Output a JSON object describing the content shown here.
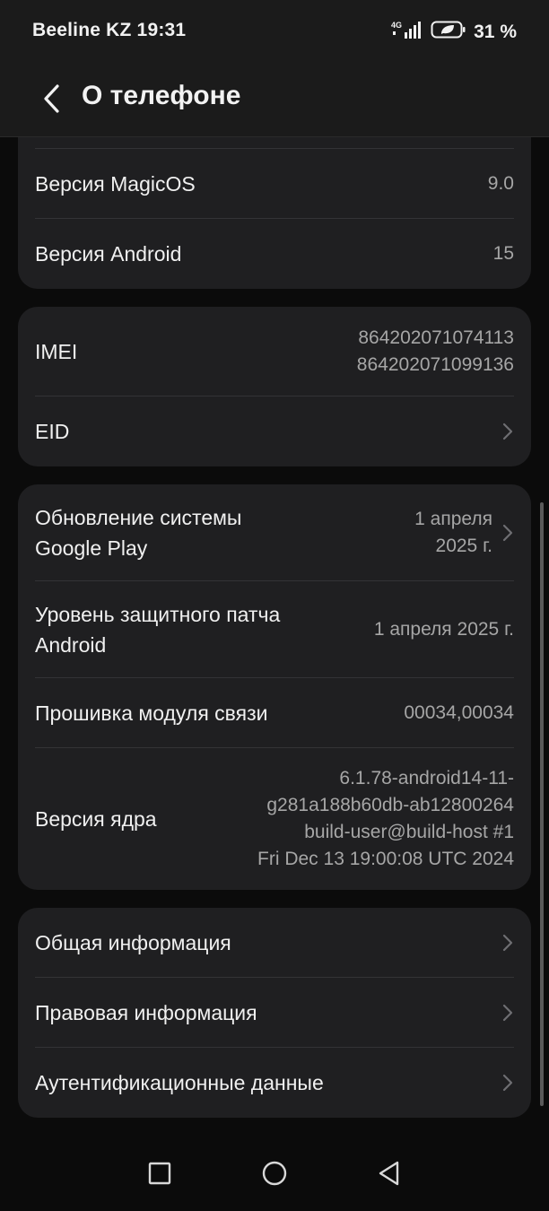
{
  "status": {
    "carrier_time": "Beeline KZ 19:31",
    "network": "4G",
    "battery": "31 %"
  },
  "header": {
    "title": "О телефоне"
  },
  "card1": {
    "rows": [
      {
        "label": "Версия MagicOS",
        "value": "9.0"
      },
      {
        "label": "Версия Android",
        "value": "15"
      }
    ]
  },
  "card2": {
    "imei_label": "IMEI",
    "imei_values": [
      "864202071074113",
      "864202071099136"
    ],
    "eid_label": "EID"
  },
  "card3": {
    "gplay_label": [
      "Обновление системы",
      "Google Play"
    ],
    "gplay_value": [
      "1 апреля",
      "2025 г."
    ],
    "patch_label": [
      "Уровень защитного патча",
      "Android"
    ],
    "patch_value": "1 апреля 2025 г.",
    "baseband_label": "Прошивка модуля связи",
    "baseband_value": "00034,00034",
    "kernel_label": "Версия ядра",
    "kernel_value": [
      "6.1.78-android14-11-",
      "g281a188b60db-ab12800264",
      "build-user@build-host #1",
      "Fri Dec 13 19:00:08 UTC 2024"
    ]
  },
  "card4": {
    "items": [
      {
        "label": "Общая информация"
      },
      {
        "label": "Правовая информация"
      },
      {
        "label": "Аутентификационные данные"
      }
    ]
  },
  "icons": {
    "back": "back-arrow-icon",
    "chevron": "chevron-right-icon",
    "nav": [
      "recents-icon",
      "home-icon",
      "back-triangle-icon"
    ]
  }
}
